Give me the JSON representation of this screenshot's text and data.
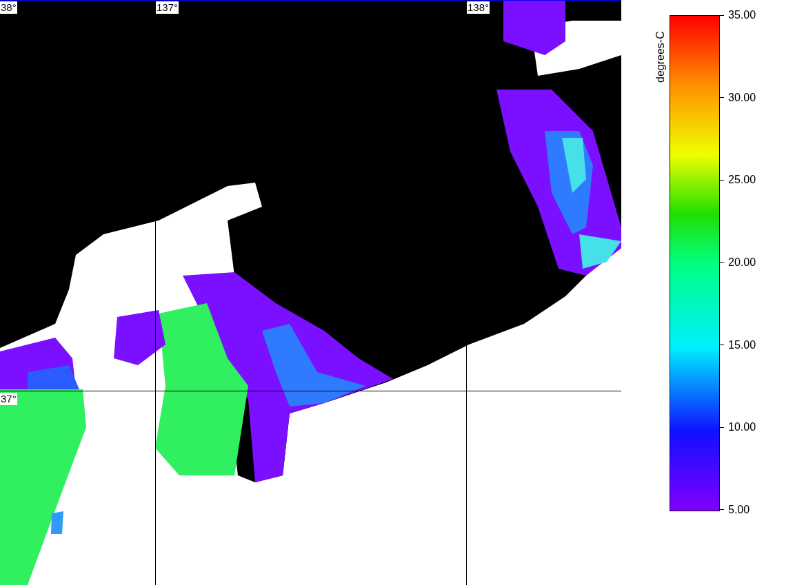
{
  "map": {
    "latitude_labels": [
      "38°",
      "37°"
    ],
    "longitude_labels": [
      "137°",
      "138°"
    ]
  },
  "legend": {
    "label": "degrees-C",
    "ticks": [
      "35.00",
      "30.00",
      "25.00",
      "20.00",
      "15.00",
      "10.00",
      "5.00"
    ]
  }
}
